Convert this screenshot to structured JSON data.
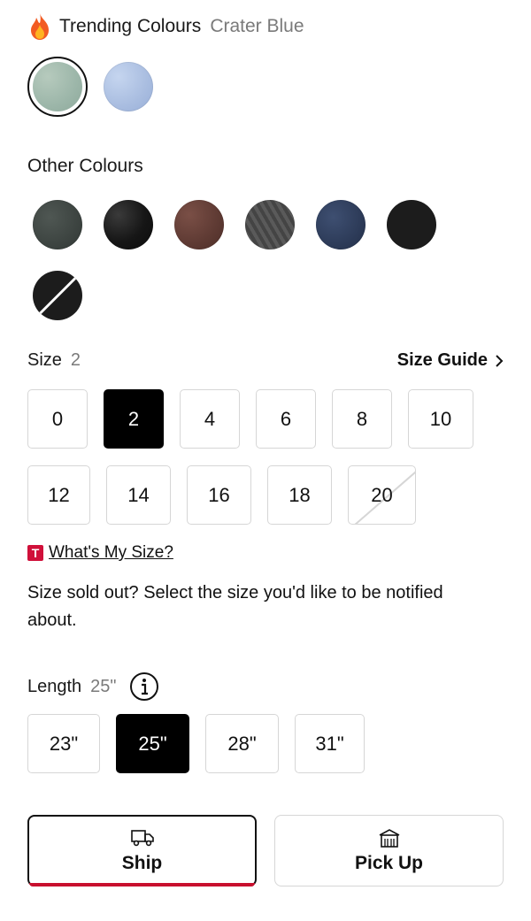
{
  "trending": {
    "title": "Trending Colours",
    "selected": "Crater Blue"
  },
  "other": {
    "title": "Other Colours"
  },
  "size": {
    "label": "Size",
    "selected": "2",
    "guide": "Size Guide",
    "options_row1": [
      "0",
      "2",
      "4",
      "6",
      "8",
      "10"
    ],
    "options_row2": [
      "12",
      "14",
      "16",
      "18",
      "20"
    ],
    "whats_my_size": "What's My Size?",
    "badge": "T",
    "note": "Size sold out? Select the size you'd like to be notified about."
  },
  "length": {
    "label": "Length",
    "selected": "25\"",
    "options": [
      "23\"",
      "25\"",
      "28\"",
      "31\""
    ]
  },
  "fulfillment": {
    "ship": "Ship",
    "pickup": "Pick Up"
  },
  "colors": {
    "accent": "#c8102e",
    "badge": "#d0103a"
  }
}
